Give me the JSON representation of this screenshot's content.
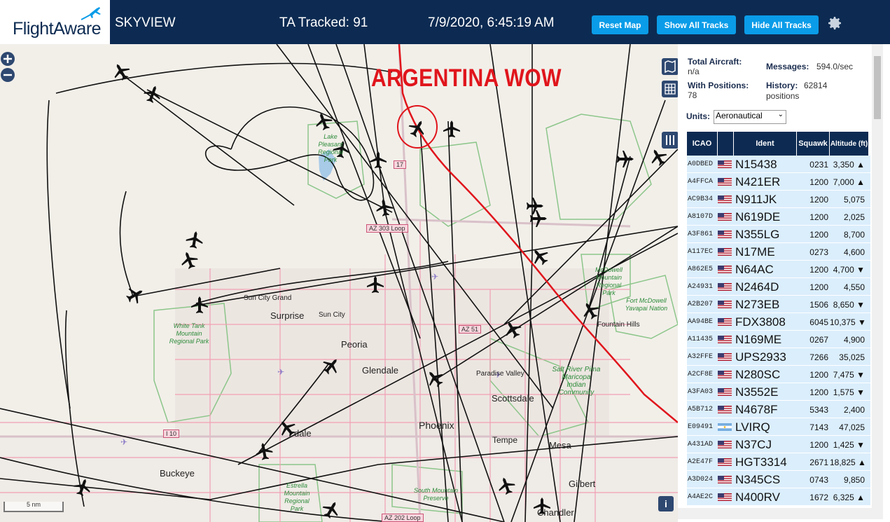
{
  "header": {
    "logo": "FlightAware",
    "app_name": "SKYVIEW",
    "tracked": "TA Tracked: 91",
    "datetime": "7/9/2020, 6:45:19 AM",
    "buttons": {
      "reset_map": "Reset Map",
      "show_all_tracks": "Show All Tracks",
      "hide_all_tracks": "Hide All Tracks"
    },
    "settings_icon": "gear-icon"
  },
  "map": {
    "annotation": "ARGENTINA WOW",
    "cities": [
      "Surprise",
      "Sun City",
      "Sun City Grand",
      "Peoria",
      "Glendale",
      "Paradise Valley",
      "Scottsdale",
      "Phoenix",
      "Tempe",
      "Mesa",
      "Gilbert",
      "Chandler",
      "Buckeye",
      "Fountain Hills",
      "Avondale"
    ],
    "avondale_partial": "dale",
    "parks": {
      "lake_pleasant": "Lake Pleasant Regional Park",
      "white_tank": "White Tank Mountain Regional Park",
      "mcdowell": "McDowell Mountain Regional Park",
      "fort_mcdowell": "Fort McDowell Yavapai Nation",
      "salt_river": "Salt River Pima Maricopa Indian Community",
      "estrella": "Estrella Mountain Regional Park",
      "south_mountain": "South Mountain Preserve"
    },
    "roads": [
      "AZ 303 Loop",
      "AZ 51",
      "I 10",
      "17",
      "AZ 202 Loop"
    ],
    "scale": "5 nm",
    "info_icon": "i",
    "colors": {
      "track": "#111111",
      "highlight": "#e0151c",
      "water": "#a8cbe8",
      "park_border": "#8cc68a",
      "urban_road": "#f19fb4"
    }
  },
  "panel": {
    "total_aircraft_label": "Total Aircraft:",
    "total_aircraft_value": "n/a",
    "with_positions_label": "With Positions:",
    "with_positions_value": "78",
    "messages_label": "Messages:",
    "messages_value": "594.0/sec",
    "history_label": "History:",
    "history_value": "62814",
    "history_unit": "positions",
    "units_label": "Units:",
    "units_value": "Aeronautical",
    "columns": [
      "ICAO",
      "Ident",
      "Squawk",
      "Altitude (ft)"
    ],
    "rows": [
      {
        "icao": "A0DBED",
        "ident": "N15438",
        "squawk": "0231",
        "alt": "3,350 ▲",
        "flag": "US"
      },
      {
        "icao": "A4FFCA",
        "ident": "N421ER",
        "squawk": "1200",
        "alt": "7,000 ▲",
        "flag": "US"
      },
      {
        "icao": "AC9B34",
        "ident": "N911JK",
        "squawk": "1200",
        "alt": "5,075",
        "flag": "US"
      },
      {
        "icao": "A8107D",
        "ident": "N619DE",
        "squawk": "1200",
        "alt": "2,025",
        "flag": "US"
      },
      {
        "icao": "A3F861",
        "ident": "N355LG",
        "squawk": "1200",
        "alt": "8,700",
        "flag": "US"
      },
      {
        "icao": "A117EC",
        "ident": "N17ME",
        "squawk": "0273",
        "alt": "4,600",
        "flag": "US"
      },
      {
        "icao": "A862E5",
        "ident": "N64AC",
        "squawk": "1200",
        "alt": "4,700 ▼",
        "flag": "US"
      },
      {
        "icao": "A24931",
        "ident": "N2464D",
        "squawk": "1200",
        "alt": "4,550",
        "flag": "US"
      },
      {
        "icao": "A2B207",
        "ident": "N273EB",
        "squawk": "1506",
        "alt": "8,650 ▼",
        "flag": "US"
      },
      {
        "icao": "AA94BE",
        "ident": "FDX3808",
        "squawk": "6045",
        "alt": "10,375 ▼",
        "flag": "US"
      },
      {
        "icao": "A11435",
        "ident": "N169ME",
        "squawk": "0267",
        "alt": "4,900",
        "flag": "US"
      },
      {
        "icao": "A32FFE",
        "ident": "UPS2933",
        "squawk": "7266",
        "alt": "35,025",
        "flag": "US"
      },
      {
        "icao": "A2CF8E",
        "ident": "N280SC",
        "squawk": "1200",
        "alt": "7,475 ▼",
        "flag": "US"
      },
      {
        "icao": "A3FA03",
        "ident": "N3552E",
        "squawk": "1200",
        "alt": "1,575 ▼",
        "flag": "US"
      },
      {
        "icao": "A5B712",
        "ident": "N4678F",
        "squawk": "5343",
        "alt": "2,400",
        "flag": "US"
      },
      {
        "icao": "E09491",
        "ident": "LVIRQ",
        "squawk": "7143",
        "alt": "47,025",
        "flag": "AR"
      },
      {
        "icao": "A431AD",
        "ident": "N37CJ",
        "squawk": "1200",
        "alt": "1,425 ▼",
        "flag": "US"
      },
      {
        "icao": "A2E47F",
        "ident": "HGT3314",
        "squawk": "2671",
        "alt": "18,825 ▲",
        "flag": "US"
      },
      {
        "icao": "A3D024",
        "ident": "N345CS",
        "squawk": "0743",
        "alt": "9,850",
        "flag": "US"
      },
      {
        "icao": "A4AE2C",
        "ident": "N400RV",
        "squawk": "1672",
        "alt": "6,325 ▲",
        "flag": "US"
      }
    ]
  }
}
